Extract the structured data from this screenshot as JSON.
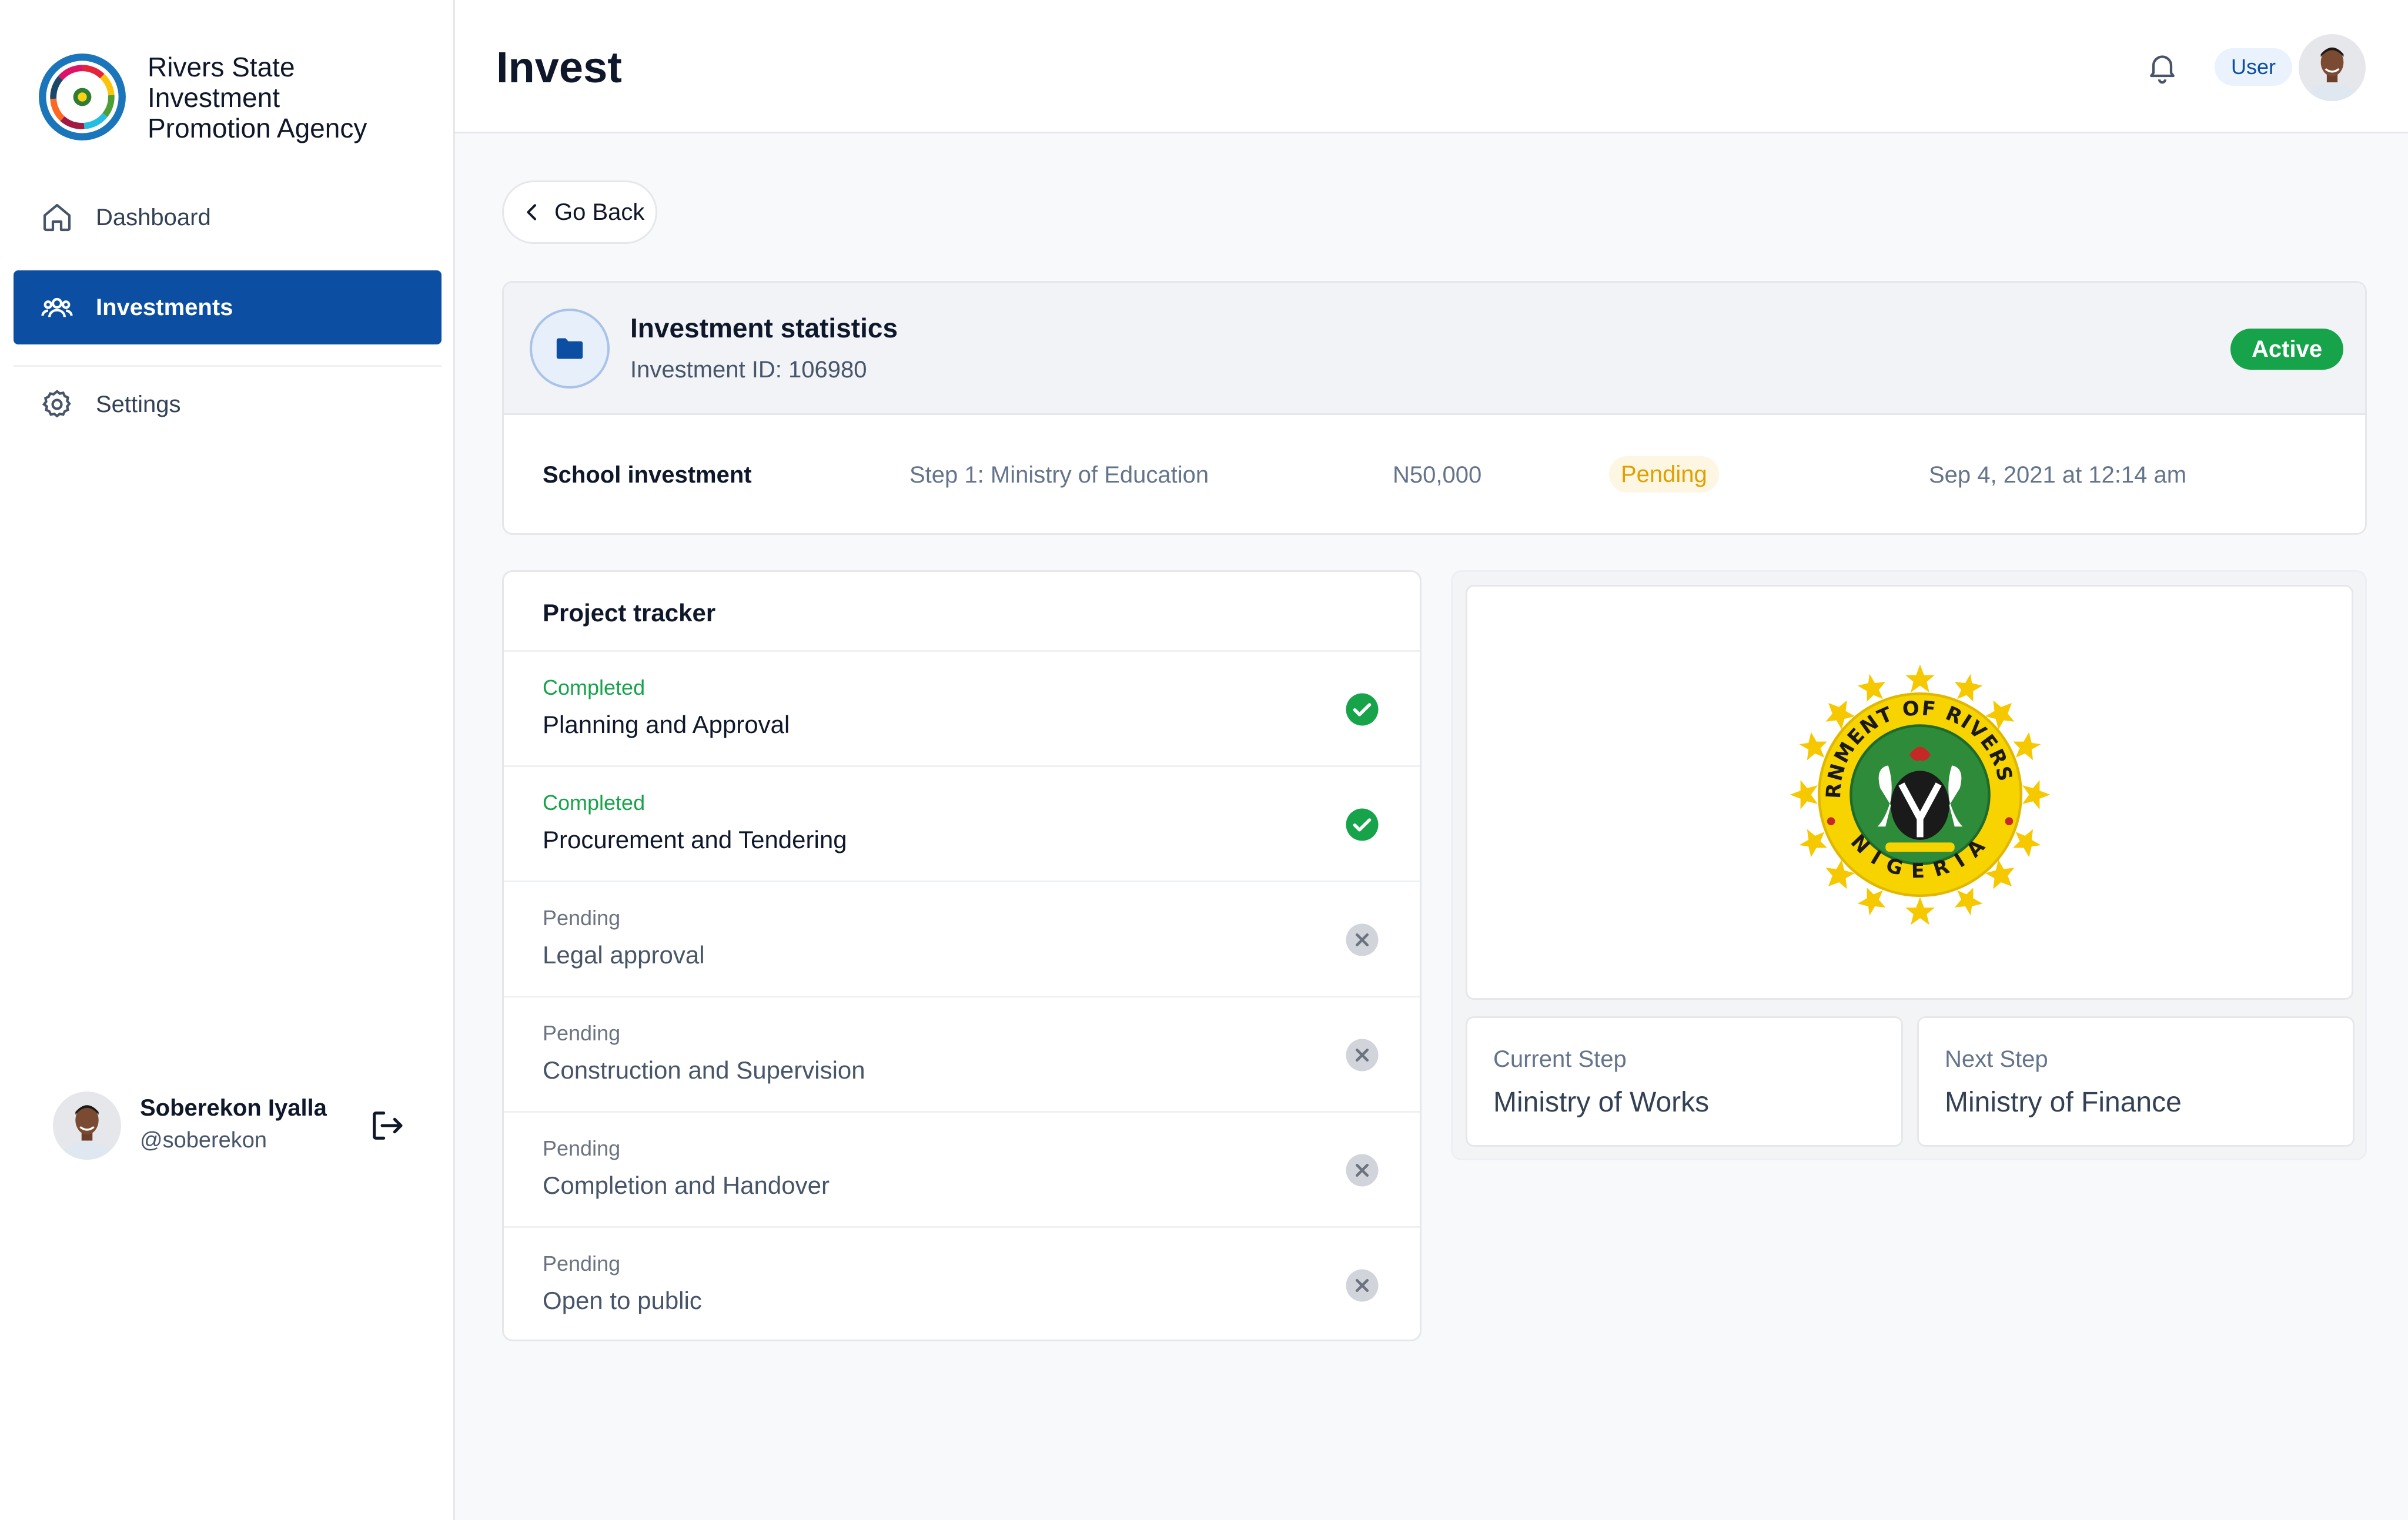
{
  "brand": {
    "name": "Rivers State\nInvestment\nPromotion Agency"
  },
  "nav": {
    "items": [
      {
        "label": "Dashboard",
        "icon": "home-icon",
        "active": false
      },
      {
        "label": "Investments",
        "icon": "users-icon",
        "active": true
      },
      {
        "label": "Settings",
        "icon": "gear-icon",
        "active": false
      }
    ]
  },
  "profile": {
    "name": "Soberekon Iyalla",
    "handle": "@soberekon"
  },
  "header": {
    "title": "Invest",
    "user_label": "User"
  },
  "actions": {
    "go_back": "Go Back"
  },
  "investment": {
    "title": "Investment statistics",
    "id_text": "Investment ID: 106980",
    "badge": "Active",
    "name": "School investment",
    "step": "Step 1: Ministry of Education",
    "amount": "N50,000",
    "status": "Pending",
    "date": "Sep 4, 2021 at 12:14 am"
  },
  "tracker": {
    "title": "Project tracker",
    "steps": [
      {
        "status": "Completed",
        "label": "Planning and Approval",
        "done": true
      },
      {
        "status": "Completed",
        "label": "Procurement and Tendering",
        "done": true
      },
      {
        "status": "Pending",
        "label": "Legal approval",
        "done": false
      },
      {
        "status": "Pending",
        "label": "Construction and Supervision",
        "done": false
      },
      {
        "status": "Pending",
        "label": "Completion and Handover",
        "done": false
      },
      {
        "status": "Pending",
        "label": "Open to public",
        "done": false
      }
    ]
  },
  "seal": {
    "top_text": "GOVERNMENT OF RIVERS STATE",
    "bottom_text": "NIGERIA"
  },
  "steps_info": {
    "current_label": "Current Step",
    "current_value": "Ministry of Works",
    "next_label": "Next Step",
    "next_value": "Ministry of Finance"
  },
  "colors": {
    "primary": "#0b4ea2",
    "success": "#16a34a",
    "warning": "#e0a100",
    "muted": "#64748b"
  }
}
